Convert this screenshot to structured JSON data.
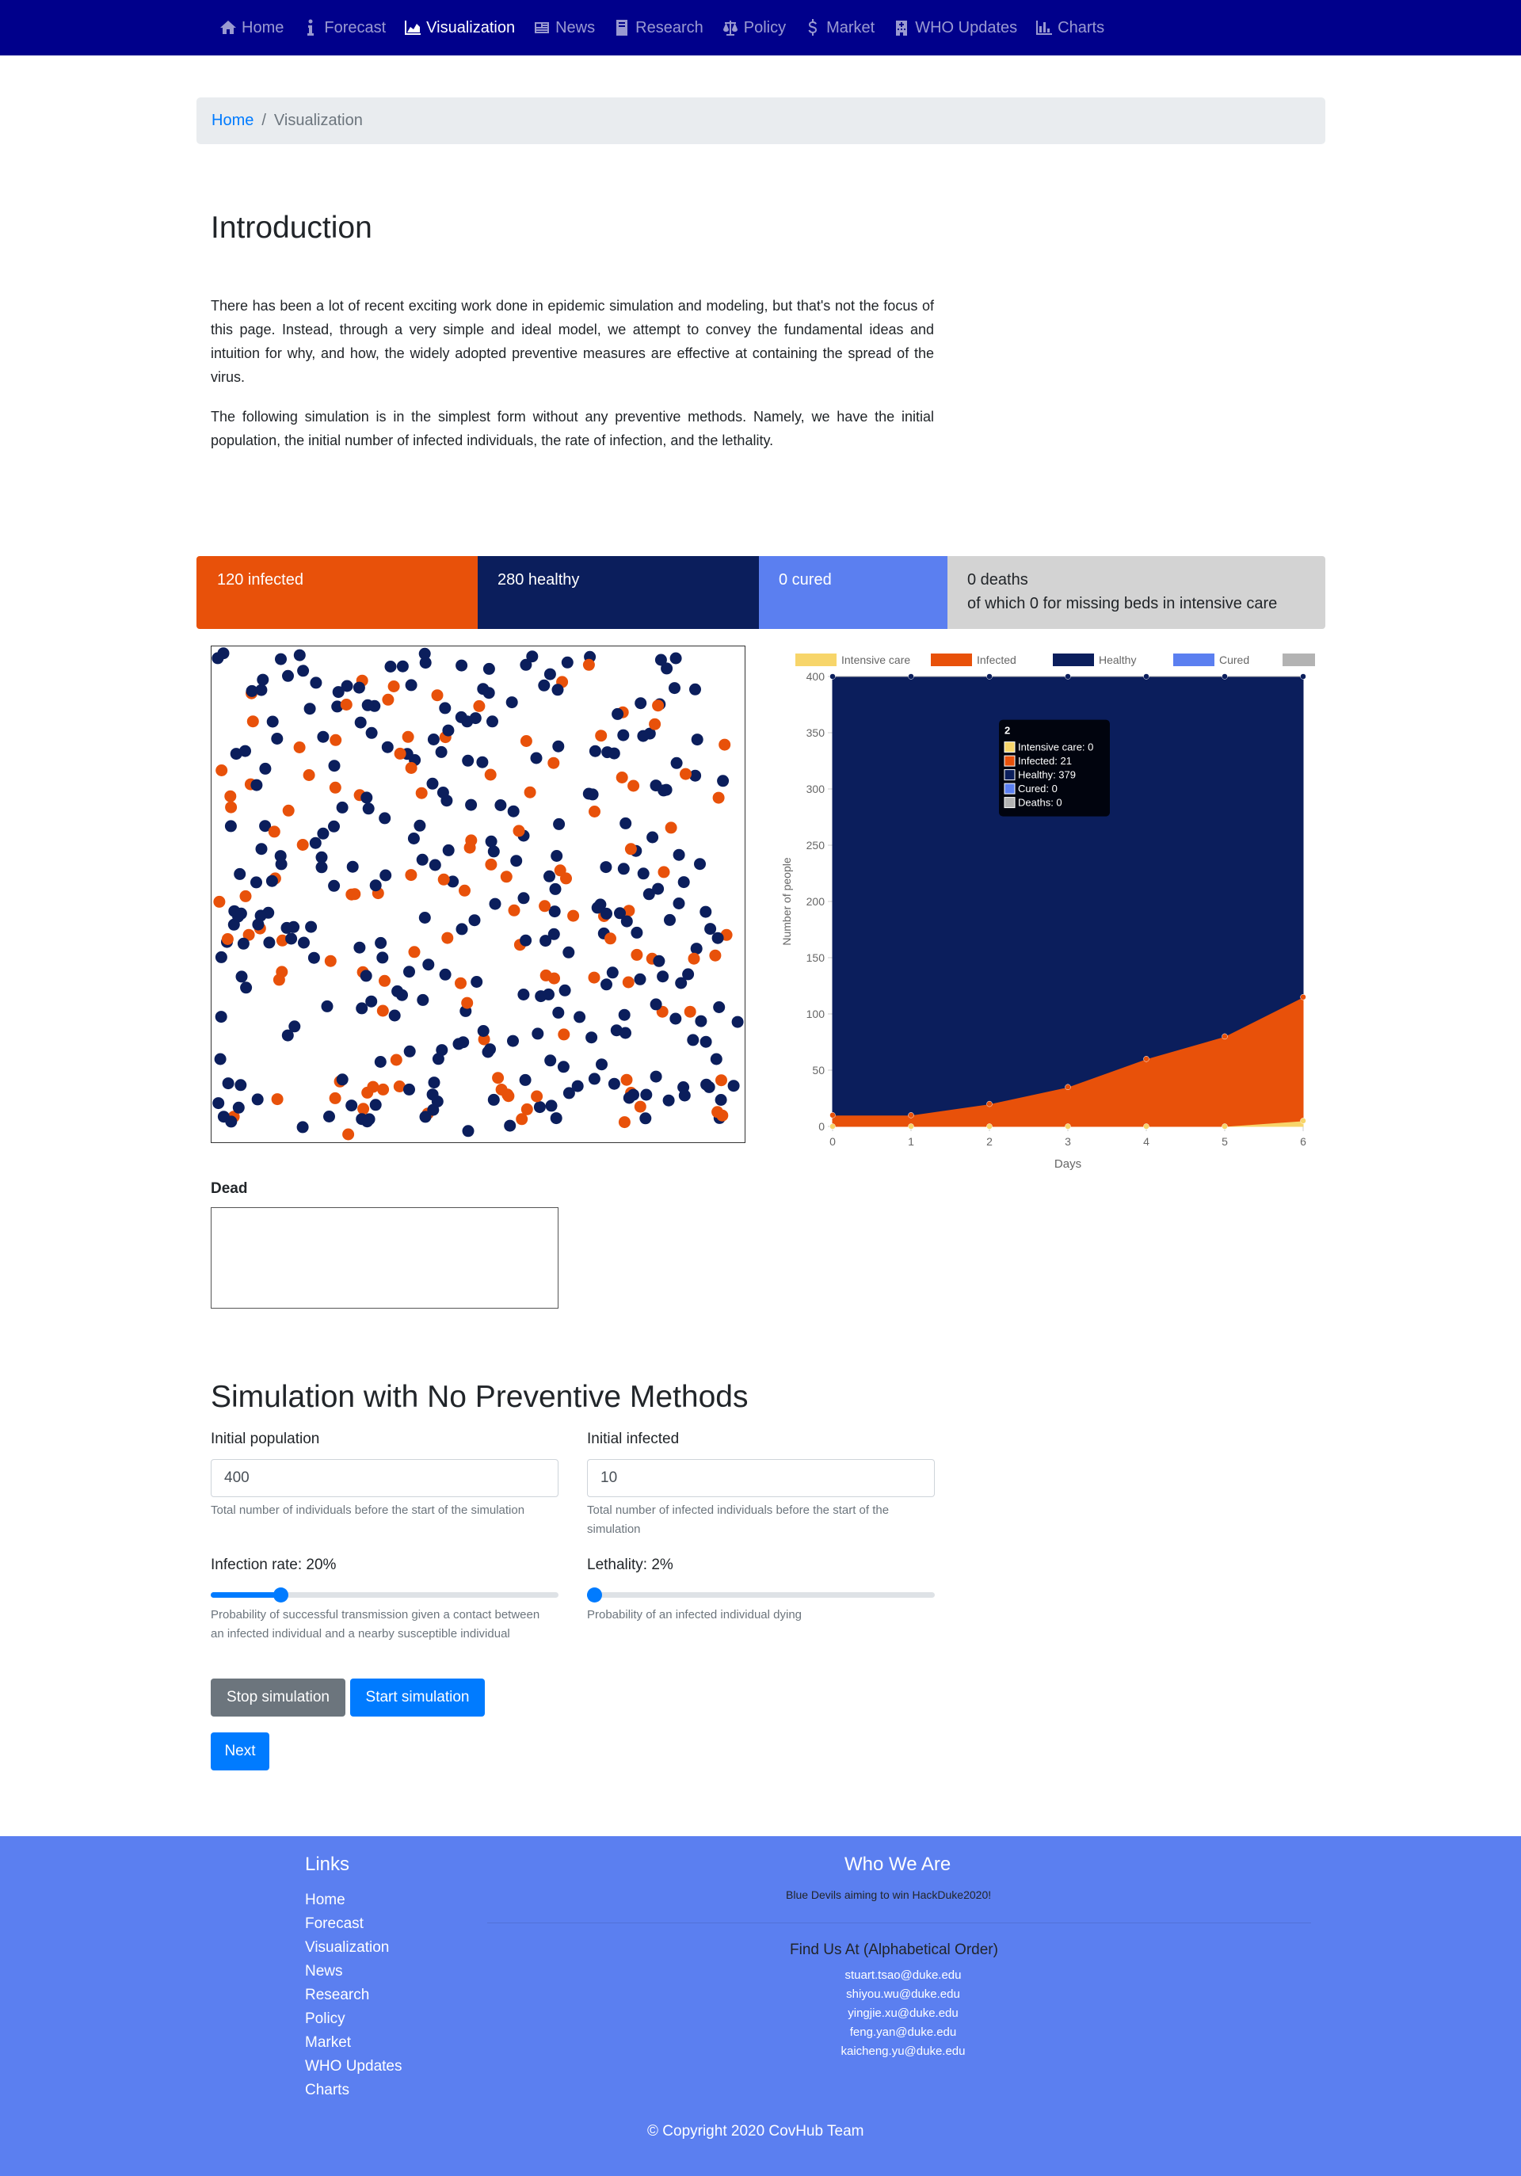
{
  "nav": {
    "items": [
      {
        "label": "Home",
        "icon": "home-icon"
      },
      {
        "label": "Forecast",
        "icon": "info-icon"
      },
      {
        "label": "Visualization",
        "icon": "area-chart-icon",
        "active": true
      },
      {
        "label": "News",
        "icon": "newspaper-icon"
      },
      {
        "label": "Research",
        "icon": "book-icon"
      },
      {
        "label": "Policy",
        "icon": "balance-scale-icon"
      },
      {
        "label": "Market",
        "icon": "dollar-icon"
      },
      {
        "label": "WHO Updates",
        "icon": "hospital-icon"
      },
      {
        "label": "Charts",
        "icon": "bar-chart-icon"
      }
    ]
  },
  "breadcrumb": {
    "home": "Home",
    "separator": "/",
    "current": "Visualization"
  },
  "intro": {
    "title": "Introduction",
    "p1": "There has been a lot of recent exciting work done in epidemic simulation and modeling, but that's not the focus of this page. Instead, through a very simple and ideal model, we attempt to convey the fundamental ideas and intuition for why, and how, the widely adopted preventive measures are effective at containing the spread of the virus.",
    "p2": "The following simulation is in the simplest form without any preventive methods. Namely, we have the initial population, the initial number of infected individuals, the rate of infection, and the lethality."
  },
  "status": {
    "infected": "120 infected",
    "healthy": "280 healthy",
    "cured": "0 cured",
    "deaths": "0 deaths",
    "deaths_sub": "of which 0 for missing beds in intensive care"
  },
  "simulation": {
    "infected_count": 120,
    "healthy_count": 280,
    "colors": {
      "infected": "#e8510a",
      "healthy": "#0b1e5c"
    }
  },
  "chart_data": {
    "type": "area",
    "x": [
      0,
      1,
      2,
      3,
      4,
      5,
      6
    ],
    "xlabel": "Days",
    "ylabel": "Number of people",
    "ylim": [
      0,
      400
    ],
    "yticks": [
      0,
      50,
      100,
      150,
      200,
      250,
      300,
      350,
      400
    ],
    "legend_position": "top",
    "series": [
      {
        "name": "Intensive care",
        "color": "#f7d56a",
        "values": [
          0,
          0,
          0,
          0,
          0,
          0,
          5
        ]
      },
      {
        "name": "Infected",
        "color": "#e8510a",
        "values": [
          10,
          10,
          20,
          35,
          60,
          80,
          110
        ]
      },
      {
        "name": "Healthy",
        "color": "#0b1e5c",
        "values": [
          390,
          390,
          380,
          365,
          340,
          320,
          285
        ]
      },
      {
        "name": "Cured",
        "color": "#5b7ff0",
        "values": [
          0,
          0,
          0,
          0,
          0,
          0,
          0
        ]
      },
      {
        "name": "Deaths",
        "color": "#b3b3b3",
        "values": [
          0,
          0,
          0,
          0,
          0,
          0,
          0
        ]
      }
    ],
    "tooltip": {
      "title": "2",
      "rows": [
        "Intensive care: 0",
        "Infected: 21",
        "Healthy: 379",
        "Cured: 0",
        "Deaths: 0"
      ]
    }
  },
  "dead": {
    "label": "Dead"
  },
  "form": {
    "title": "Simulation with No Preventive Methods",
    "population_label": "Initial population",
    "population_value": "400",
    "population_help": "Total number of individuals before the start of the simulation",
    "infected_label": "Initial infected",
    "infected_value": "10",
    "infected_help": "Total number of infected individuals before the start of the simulation",
    "infection_rate_label": "Infection rate: 20%",
    "infection_rate_value": 0.2,
    "infection_rate_help": "Probability of successful transmission given a contact between an infected individual and a nearby susceptible individual",
    "lethality_label": "Lethality: 2%",
    "lethality_value": 0.02,
    "lethality_help": "Probability of an infected individual dying",
    "stop_label": "Stop simulation",
    "start_label": "Start simulation",
    "next_label": "Next"
  },
  "footer": {
    "links_title": "Links",
    "links": [
      "Home",
      "Forecast",
      "Visualization",
      "News",
      "Research",
      "Policy",
      "Market",
      "WHO Updates",
      "Charts"
    ],
    "who_title": "Who We Are",
    "who_sub": "Blue Devils aiming to win HackDuke2020!",
    "find_title": "Find Us At (Alphabetical Order)",
    "emails": [
      "stuart.tsao@duke.edu",
      "shiyou.wu@duke.edu",
      "yingjie.xu@duke.edu",
      "feng.yan@duke.edu",
      "kaicheng.yu@duke.edu"
    ],
    "copyright": "© Copyright 2020 CovHub Team"
  }
}
